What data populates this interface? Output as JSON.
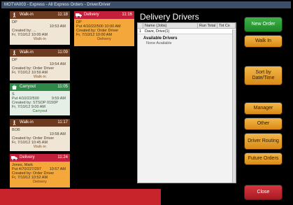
{
  "window": {
    "title": "MOTVA003 - Express - All Express Orders - Driver/Driver"
  },
  "orders": [
    {
      "type": "Walk-in",
      "time": "11:18",
      "lines": [
        "DP",
        "",
        "Created by: ...",
        "Fr, 7/10/12 10:00 AM"
      ],
      "right": "10:53 AM",
      "status": "Walk-in",
      "kind": "walkin"
    },
    {
      "type": "Delivery",
      "time": "11:16",
      "lines": [
        "DP",
        "Put 4/10/22/500 10:00 AM",
        "Created by: Order Driver",
        "Fr, 7/10/12 10:00 AM"
      ],
      "right": "",
      "status": "Delivery",
      "kind": "delivery"
    },
    {
      "type": "Walk-in",
      "time": "11:09",
      "lines": [
        "DP",
        "",
        "Created by: Order Driver",
        "Fr, 7/10/12 10:59 AM"
      ],
      "right": "10:54 AM",
      "status": "Walk-in",
      "kind": "walkin"
    },
    {
      "type": "Carryout",
      "time": "11:05",
      "lines": [
        "S",
        "Put 4/10/22/500",
        "Created by: STSOP 0150P",
        "Fr, 7/10/12 9:00 AM"
      ],
      "right": "9:59 AM",
      "status": "Carryout",
      "kind": "carryout"
    },
    {
      "type": "Walk-in",
      "time": "11:17",
      "lines": [
        "BOB",
        "",
        "Created by: Order Driver",
        "Fr, 7/10/12 10:45 AM"
      ],
      "right": "10:58 AM",
      "status": "Walk-in",
      "kind": "walkin"
    },
    {
      "type": "Delivery",
      "time": "11:24",
      "lines": [
        "Jones, Mark",
        "Put 4/70/227/297",
        "Created by: Order Driver",
        "Fr, 7/10/12 10:52 AM"
      ],
      "right": "10:57 AM",
      "status": "Delivery",
      "kind": "delivery"
    }
  ],
  "drivers_panel": {
    "title": "Delivery Drivers",
    "columns": [
      "",
      "Name (Jobs)",
      "Run Total",
      "Tot Cx"
    ],
    "rows": [
      {
        "idx": "1",
        "name": "Dave, Drive(1)",
        "run": "",
        "tot": ""
      }
    ],
    "available_label": "Available Drivers",
    "available_value": "None Available"
  },
  "buttons": {
    "new_order": "New Order",
    "walk_in": "Walk In",
    "sort": "Sort by Date/Time",
    "manager": "Manager",
    "other": "Other",
    "driver_routing": "Driver Routing",
    "future_orders": "Future Orders",
    "close": "Close"
  },
  "colors": {
    "accent_green": "#1e8a2a",
    "accent_orange": "#d98a16",
    "accent_red": "#c41f3a"
  }
}
